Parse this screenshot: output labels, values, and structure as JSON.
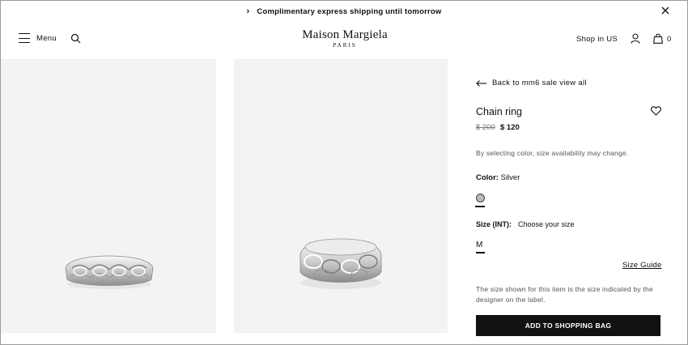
{
  "announcement": {
    "text": "Complimentary express shipping until tomorrow",
    "chevron": "›"
  },
  "header": {
    "menu_label": "Menu",
    "logo_name": "Maison Margiela",
    "logo_sub": "PARIS",
    "shop_in": "Shop in US",
    "bag_count": "0"
  },
  "product": {
    "back_label": "Back to mm6 sale view all",
    "name": "Chain ring",
    "price_old": "$ 200",
    "price_new": "$ 120",
    "note": "By selecting color, size availability may change.",
    "color_label": "Color:",
    "color_value": "Silver",
    "swatch_color": "#b8b8bf",
    "size_label": "Size (INT):",
    "size_choose": "Choose your size",
    "size_option": "M",
    "size_guide": "Size Guide",
    "size_info": "The size shown for this item is the size indicated by the designer on the label.",
    "add_button": "ADD TO SHOPPING BAG"
  },
  "icons": [
    "chevron-right-icon",
    "close-icon",
    "hamburger-icon",
    "search-icon",
    "user-icon",
    "bag-icon",
    "arrow-left-icon",
    "heart-icon"
  ],
  "colors": {
    "image_bg": "#f3f3f3",
    "button_bg": "#111111",
    "text_muted": "#555555"
  }
}
